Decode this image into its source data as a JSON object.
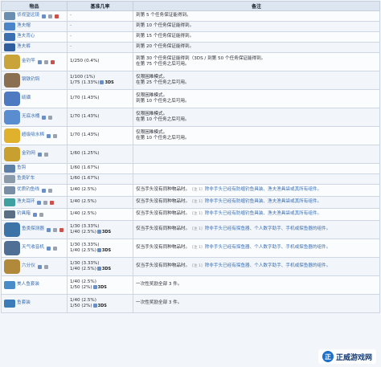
{
  "headers": {
    "item": "物品",
    "rate": "基准几率",
    "note": "备注"
  },
  "rows": [
    {
      "name": "侦视望远镜",
      "icon": "spyglass-icon",
      "color": "#6b8fb0",
      "minis": [
        "blue",
        "gray",
        "red"
      ],
      "rates": [
        "-"
      ],
      "notes": [
        "到第 5 个任务保证能得到。"
      ]
    },
    {
      "name": "渔夫帽",
      "icon": "angler-hat-icon",
      "color": "#4b84c8",
      "minis": [],
      "rates": [
        "-"
      ],
      "notes": [
        "到第 10 个任务保证能得到。"
      ]
    },
    {
      "name": "渔夫背心",
      "icon": "angler-vest-icon",
      "color": "#3c6fb2",
      "minis": [],
      "rates": [
        "-"
      ],
      "notes": [
        "到第 15 个任务保证能得到。"
      ]
    },
    {
      "name": "渔夫裤",
      "icon": "angler-pants-icon",
      "color": "#2f5f9f",
      "minis": [],
      "rates": [
        "-"
      ],
      "notes": [
        "到第 20 个任务保证能得到。"
      ]
    },
    {
      "name": "金钓竿",
      "icon": "golden-rod-icon",
      "color": "#c9a43a",
      "minis": [
        "blue",
        "gray",
        "red"
      ],
      "big": true,
      "rates": [
        "1/250 (0.4%)"
      ],
      "notes": [
        "到第 30 个任务保证能得到（3DS / 到第 50 个任务保证能得到。",
        "在第 75 个任务之后可用。"
      ]
    },
    {
      "name": "钢铁钓钩",
      "icon": "hook-icon",
      "color": "#8a7050",
      "minis": [],
      "big": true,
      "rates": [
        "1/100 (1%)",
        "1/75 (1.33%)"
      ],
      "notes": [
        "仅限困难模式。",
        "在第 25 个任务之后可用。"
      ]
    },
    {
      "name": "硫磺",
      "icon": "sulfur-icon",
      "color": "#4d7ac0",
      "minis": [],
      "big": true,
      "rates": [
        "1/70 (1.43%)"
      ],
      "notes": [
        "仅限困难模式。",
        "到第 10 个任务之后可用。"
      ]
    },
    {
      "name": "无底水桶",
      "icon": "bottomless-bucket-icon",
      "color": "#5a8cd0",
      "minis": [
        "blue",
        "gray"
      ],
      "big": true,
      "rates": [
        "1/70 (1.43%)"
      ],
      "notes": [
        "仅限困难模式。",
        "在第 10 个任务之后可用。"
      ]
    },
    {
      "name": "超级吸水棉",
      "icon": "sponge-icon",
      "color": "#e0b12d",
      "minis": [
        "blue",
        "gray"
      ],
      "big": true,
      "rates": [
        "1/70 (1.43%)"
      ],
      "notes": [
        "仅限困难模式。",
        "在第 10 个任务之后可用。"
      ]
    },
    {
      "name": "金钓网",
      "icon": "golden-net-icon",
      "color": "#c8a030",
      "minis": [
        "blue",
        "gray"
      ],
      "big": true,
      "rates": [
        "1/60 (1.25%)"
      ],
      "notes": []
    },
    {
      "name": "鱼钩",
      "icon": "fish-hook-icon",
      "color": "#5c7fa8",
      "minis": [],
      "rates": [
        "1/60 (1.67%)"
      ],
      "notes": []
    },
    {
      "name": "鱼类矿车",
      "icon": "minecart-icon",
      "color": "#8a9aa8",
      "minis": [],
      "rates": [
        "1/60 (1.67%)"
      ],
      "notes": []
    },
    {
      "name": "优质钓鱼线",
      "icon": "fishing-line-icon",
      "color": "#7a8fa5",
      "minis": [
        "blue",
        "gray"
      ],
      "rates": [
        "1/40 (2.5%)"
      ],
      "notes": [
        "仅当手头没有同种物品时。",
        "[注 1]",
        "除非手头已经有防缠钓鱼具装、渔夫渔具袋或其所有组件。"
      ]
    },
    {
      "name": "渔夫耳环",
      "icon": "earring-icon",
      "color": "#3fa0a0",
      "minis": [
        "blue",
        "gray",
        "red"
      ],
      "rates": [
        "1/40 (2.5%)"
      ],
      "notes": [
        "仅当手头没有同种物品时。",
        "[注 1]",
        "除非手头已经有防缠钓鱼具装、渔夫渔具袋或其所有组件。"
      ]
    },
    {
      "name": "钓具箱",
      "icon": "tackle-box-icon",
      "color": "#5a6f85",
      "minis": [
        "blue",
        "gray"
      ],
      "rates": [
        "1/40 (2.5%)"
      ],
      "notes": [
        "仅当手头没有同种物品时。",
        "[注 1]",
        "除非手头已经有防缠钓鱼具装、渔夫渔具袋或其所有组件。"
      ]
    },
    {
      "name": "鱼类探测器",
      "icon": "fish-finder-icon",
      "color": "#3c74a8",
      "minis": [
        "blue",
        "gray",
        "red"
      ],
      "big": true,
      "rates": [
        "1/30 (3.33%)",
        "1/40 (2.5%)"
      ],
      "notes": [
        "仅当手头没有同种物品时。",
        "[注 1]",
        "除非手头已经有探鱼器、个人数字助手、手机或探鱼器的组件。"
      ]
    },
    {
      "name": "天气收音机",
      "icon": "weather-radio-icon",
      "color": "#4f6f95",
      "minis": [
        "blue",
        "gray"
      ],
      "big": true,
      "rates": [
        "1/30 (3.33%)",
        "1/40 (2.5%)"
      ],
      "notes": [
        "仅当手头没有同种物品时。",
        "[注 1]",
        "除非手头已经有探鱼器、个人数字助手、手机或探鱼器的组件。"
      ]
    },
    {
      "name": "六分仪",
      "icon": "sextant-icon",
      "color": "#b08a3a",
      "minis": [
        "blue",
        "gray"
      ],
      "big": true,
      "rates": [
        "1/30 (3.33%)",
        "1/40 (2.5%)"
      ],
      "notes": [
        "仅当手头没有同种物品时。",
        "[注 1]",
        "除非手头已经有探鱼器、个人数字助手、手机或探鱼器的组件。"
      ]
    },
    {
      "name": "美人鱼套装",
      "icon": "mermaid-set-icon",
      "color": "#4a8cc8",
      "minis": [],
      "rates": [
        "1/40 (2.5%)",
        "1/50 (2%)"
      ],
      "ds_line": 1,
      "notes": [
        "一次性奖励全部 3 件。"
      ]
    },
    {
      "name": "鱼套装",
      "icon": "fish-set-icon",
      "color": "#3b7cb8",
      "minis": [],
      "rates": [
        "1/40 (2.5%)",
        "1/50 (2%)"
      ],
      "ds_line": 1,
      "notes": [
        "一次性奖励全部 3 件。"
      ]
    }
  ],
  "platform_tag": "3DS",
  "watermark": {
    "logo": "正",
    "text": "正威游戏网"
  }
}
